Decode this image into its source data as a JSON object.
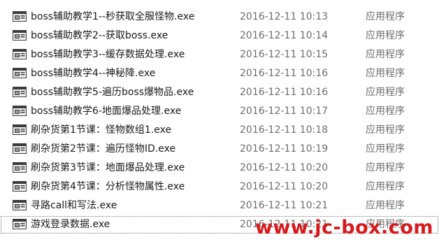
{
  "files": [
    {
      "name": "boss辅助教学1--秒获取全服怪物.exe",
      "date": "2016-12-11 10:13",
      "type": "应用程序",
      "icon": "exe-icon"
    },
    {
      "name": "boss辅助教学2--获取boss.exe",
      "date": "2016-12-11 10:14",
      "type": "应用程序",
      "icon": "exe-icon"
    },
    {
      "name": "boss辅助教学3--缓存数据处理.exe",
      "date": "2016-12-11 10:15",
      "type": "应用程序",
      "icon": "exe-icon"
    },
    {
      "name": "boss辅助教学4--神秘降.exe",
      "date": "2016-12-11 10:16",
      "type": "应用程序",
      "icon": "exe-icon"
    },
    {
      "name": "boss辅助教学5-遍历boss爆物品.exe",
      "date": "2016-12-11 10:16",
      "type": "应用程序",
      "icon": "exe-icon"
    },
    {
      "name": "boss辅助教学6-地面爆品处理.exe",
      "date": "2016-12-11 10:17",
      "type": "应用程序",
      "icon": "exe-icon"
    },
    {
      "name": "刷杂货第1节课：怪物数组1.exe",
      "date": "2016-12-11 10:18",
      "type": "应用程序",
      "icon": "exe-icon"
    },
    {
      "name": "刷杂货第2节课：遍历怪物ID.exe",
      "date": "2016-12-11 10:19",
      "type": "应用程序",
      "icon": "exe-icon"
    },
    {
      "name": "刷杂货第3节课：地面爆品处理.exe",
      "date": "2016-12-11 10:20",
      "type": "应用程序",
      "icon": "exe-icon"
    },
    {
      "name": "刷杂货第4节课：分析怪物属性.exe",
      "date": "2016-12-11 10:20",
      "type": "应用程序",
      "icon": "exe-icon"
    },
    {
      "name": "寻路call和写法.exe",
      "date": "2016-12-11 10:21",
      "type": "应用程序",
      "icon": "exe-icon"
    },
    {
      "name": "游戏登录数据.exe",
      "date": "2016-12-11 10:21",
      "type": "应用程序",
      "icon": "exe-icon",
      "selected": true
    }
  ],
  "watermark": "www.jc-box.com",
  "colors": {
    "name_text": "#1a1a1a",
    "meta_text": "#6d6d6d",
    "watermark": "#d7191c"
  }
}
